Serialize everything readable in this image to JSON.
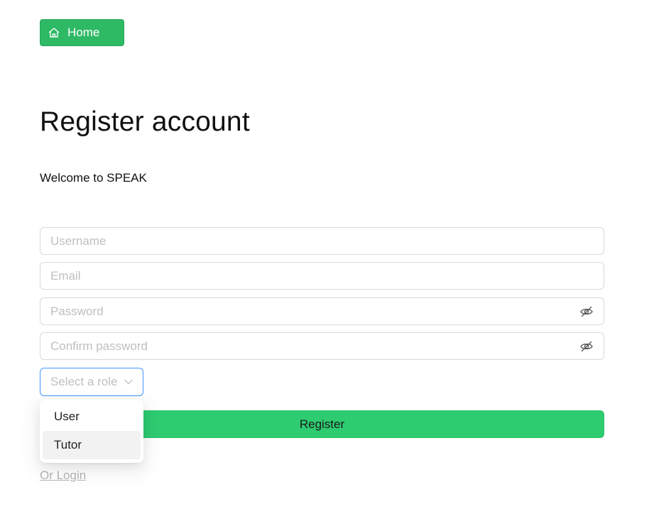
{
  "nav": {
    "home_label": "Home",
    "home_icon": "home-icon"
  },
  "header": {
    "title": "Register account",
    "subtitle": "Welcome to SPEAK"
  },
  "form": {
    "username": {
      "value": "",
      "placeholder": "Username"
    },
    "email": {
      "value": "",
      "placeholder": "Email"
    },
    "password": {
      "value": "",
      "placeholder": "Password",
      "icon": "eye-invisible-icon"
    },
    "confirm_password": {
      "value": "",
      "placeholder": "Confirm password",
      "icon": "eye-invisible-icon"
    },
    "role": {
      "placeholder": "Select a role",
      "selected": "",
      "options": [
        "User",
        "Tutor"
      ],
      "highlighted": "Tutor",
      "icon": "chevron-down-icon"
    },
    "register_label": "Register"
  },
  "footer": {
    "login_link": "Or Login"
  },
  "colors": {
    "primary_green": "#2ecc71",
    "home_green": "#2eb965",
    "focus_blue": "#4096ff",
    "placeholder": "#bfbfbf"
  }
}
